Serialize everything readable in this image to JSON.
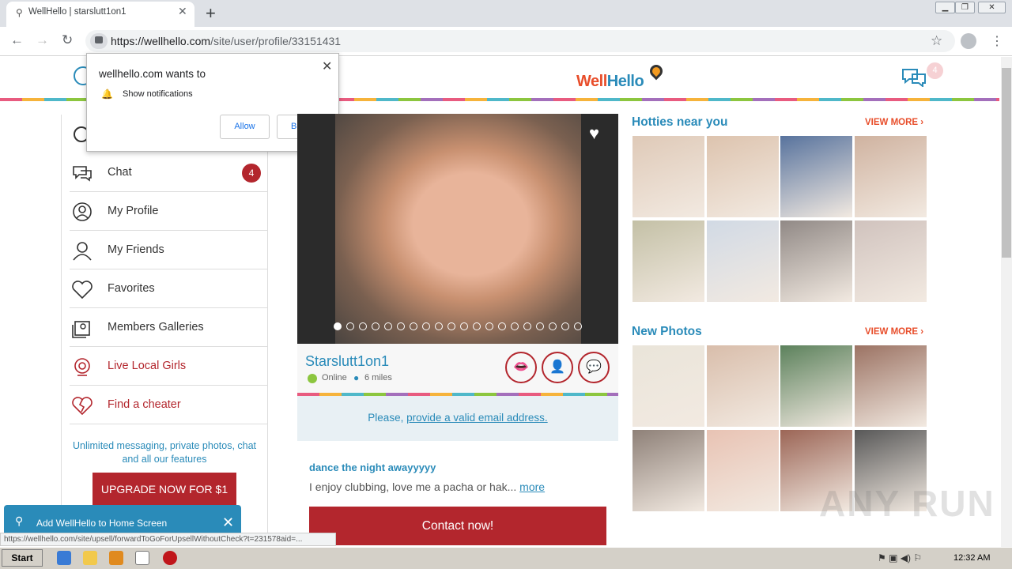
{
  "browser": {
    "tab_title": "WellHello | starslutt1on1",
    "url_host": "https://wellhello.com",
    "url_path": "/site/user/profile/33151431",
    "status_url": "https://wellhello.com/site/upsell/forwardToGoForUpsellWithoutCheck?t=231578aid=..."
  },
  "header": {
    "logo_part1": "Well",
    "logo_part2": "Hello",
    "chat_count": "4"
  },
  "notification_popup": {
    "title": "wellhello.com wants to",
    "permission": "Show notifications",
    "allow_label": "Allow",
    "block_label": "Block"
  },
  "sidebar": {
    "items": [
      {
        "label": "Chat",
        "icon": "chat-icon"
      },
      {
        "label": "My Profile",
        "icon": "user-icon"
      },
      {
        "label": "My Friends",
        "icon": "friend-icon"
      },
      {
        "label": "Favorites",
        "icon": "heart-icon"
      },
      {
        "label": "Members Galleries",
        "icon": "gallery-icon"
      },
      {
        "label": "Live Local Girls",
        "icon": "webcam-icon"
      },
      {
        "label": "Find a cheater",
        "icon": "broken-heart-icon"
      }
    ],
    "chat_badge": "4",
    "upgrade_text": "Unlimited messaging, private photos, chat and all our features",
    "upgrade_button": "UPGRADE NOW FOR $1"
  },
  "profile": {
    "name": "Starslutt1on1",
    "status": "Online",
    "distance": "6 miles",
    "email_prompt": "Please,",
    "email_link": "provide a valid email address.",
    "headline": "dance the night awayyyyy",
    "about": "I enjoy clubbing, love me a pacha or hak...",
    "about_more": "more",
    "contact_button": "Contact now!"
  },
  "right": {
    "hotties_title": "Hotties near you",
    "new_photos_title": "New Photos",
    "view_more": "VIEW MORE ›"
  },
  "a2hs": {
    "label": "Add WellHello to Home Screen"
  },
  "watermark": "ANY RUN",
  "taskbar": {
    "start": "Start",
    "clock": "12:32 AM"
  },
  "colors": {
    "brand_blue": "#2a8bb9",
    "brand_red": "#b3262d",
    "logo_orange": "#e84e2b"
  }
}
